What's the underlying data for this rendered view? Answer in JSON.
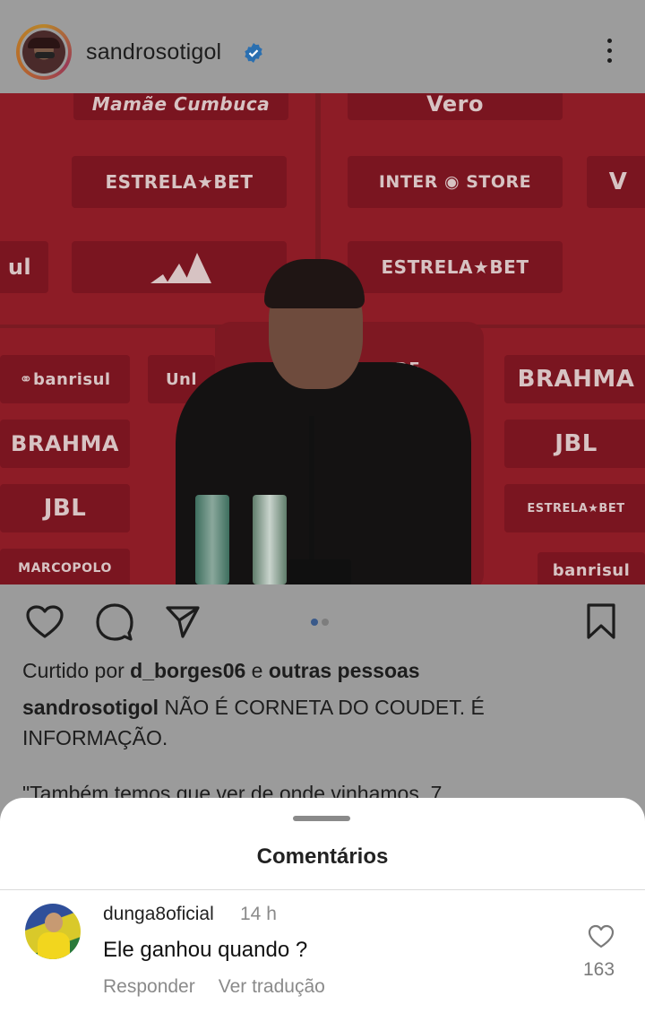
{
  "post": {
    "username": "sandrosotigol",
    "verified_icon": "verified-badge-icon",
    "more_icon": "more-vertical-icon",
    "media_brands": {
      "top_left": "Mamãe Cumbuca",
      "top_right": "Vero",
      "estrela_top": "ESTRELA★BET",
      "inter_store": "INTER ◉ STORE",
      "estrela_mid": "ESTRELA★BET",
      "banrisul": "⚭banrisul",
      "unl": "Unl",
      "brahma_left": "BRAHMA",
      "jbl_left": "JBL",
      "marcopolo": "MARCOPOLO",
      "brahma_right": "BRAHMA",
      "jbl_right": "JBL",
      "estrela_right": "ESTRELA★BET",
      "banrisul_right": "banrisul",
      "rode": "RODE",
      "ul": "ul",
      "v_right": "V"
    },
    "liked_prefix": "Curtido por ",
    "liked_user": "d_borges06",
    "liked_suffix": " e ",
    "liked_others": "outras pessoas",
    "caption_user": "sandrosotigol",
    "caption_text": " NÃO É CORNETA DO COUDET. É INFORMAÇÃO.",
    "caption_more": "\"Também temos que ver de onde vinhamos, 7"
  },
  "sheet": {
    "title": "Comentários"
  },
  "comments": [
    {
      "username": "dunga8oficial",
      "time": "14 h",
      "text": "Ele ganhou quando ?",
      "reply_label": "Responder",
      "translate_label": "Ver tradução",
      "likes": "163"
    }
  ]
}
